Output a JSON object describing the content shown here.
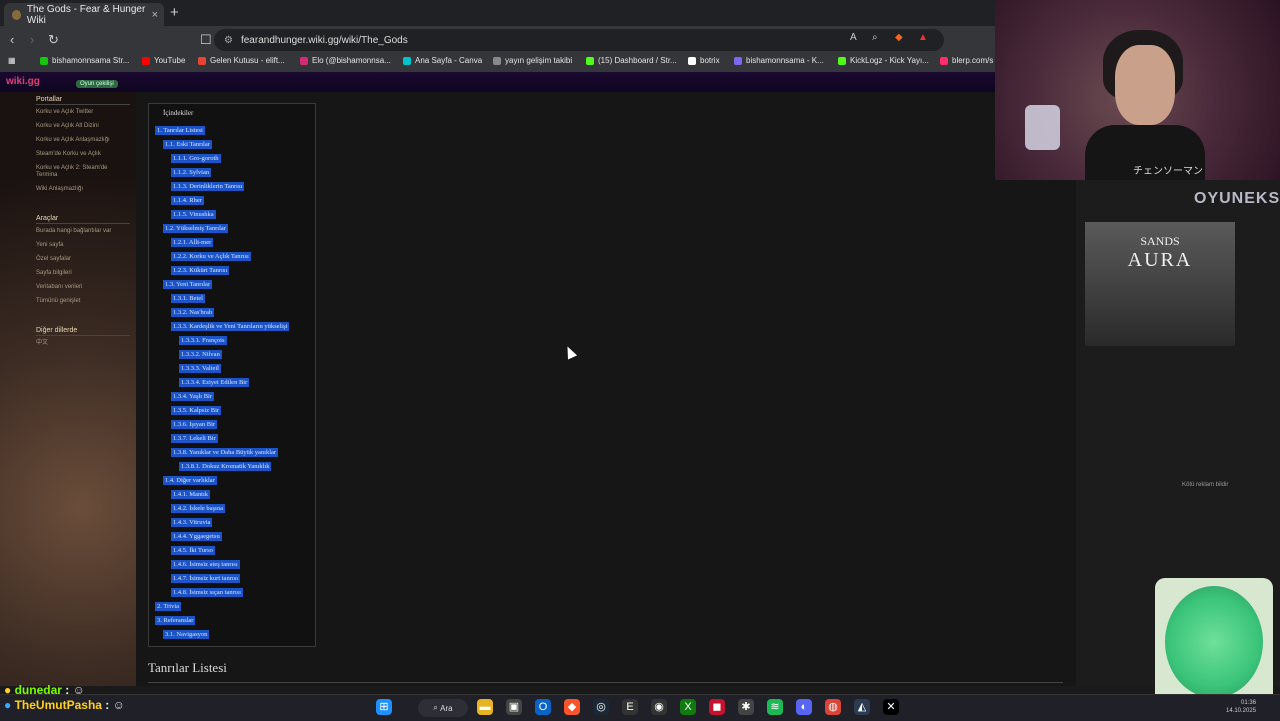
{
  "browser": {
    "tab_title": "The Gods - Fear & Hunger Wiki",
    "tab_close": "×",
    "new_tab": "+",
    "url": "fearandhunger.wiki.gg/wiki/The_Gods",
    "bookmarks": [
      {
        "label": "bishamonnsama Str...",
        "color": "#16c60c"
      },
      {
        "label": "YouTube",
        "color": "#ff0000"
      },
      {
        "label": "Gelen Kutusu - elift...",
        "color": "#ea4335"
      },
      {
        "label": "Elo (@bishamonnsa...",
        "color": "#d62976"
      },
      {
        "label": "Ana Sayfa - Canva",
        "color": "#00c4cc"
      },
      {
        "label": "yayın gelişim takibi",
        "color": "#888888"
      },
      {
        "label": "(15) Dashboard / Str...",
        "color": "#53fc18"
      },
      {
        "label": "botrix",
        "color": "#ffffff"
      },
      {
        "label": "bishamonnsama - K...",
        "color": "#7b68ee"
      },
      {
        "label": "KickLogz - Kick Yayı...",
        "color": "#53fc18"
      },
      {
        "label": "blerp.com/s",
        "color": "#ff2d6b"
      }
    ]
  },
  "wiki": {
    "logo": "wiki.gg",
    "badge": "Oyun çekilişi"
  },
  "sidebar": {
    "portals_title": "Portallar",
    "portals": [
      "Korku ve Açlık Twitter",
      "Korku ve Açlık Alt Dizini",
      "Korku ve Açlık Anlaşmazlığı",
      "Steam'de Korku ve Açlık",
      "Korku ve Açlık 2: Steam'de Termina",
      "Wiki Anlaşmazlığı"
    ],
    "tools_title": "Araçlar",
    "tools": [
      "Burada hangi bağlantılar var",
      "Yeni sayfa",
      "Özel sayfalar",
      "Sayfa bilgileri",
      "Veritabanı verileri",
      "Tümünü genişlet"
    ],
    "langs_title": "Diğer dillerde",
    "langs": [
      "中文"
    ]
  },
  "toc": {
    "title": "İçindekiler",
    "items": [
      {
        "num": "1.",
        "label": "Tanrılar Listesi",
        "level": 0
      },
      {
        "num": "1.1.",
        "label": "Eski Tanrılar",
        "level": 1
      },
      {
        "num": "1.1.1.",
        "label": "Gro-goroth",
        "level": 2
      },
      {
        "num": "1.1.2.",
        "label": "Sylvian",
        "level": 2
      },
      {
        "num": "1.1.3.",
        "label": "Derinliklerin Tanrısı",
        "level": 2
      },
      {
        "num": "1.1.4.",
        "label": "Rher",
        "level": 2
      },
      {
        "num": "1.1.5.",
        "label": "Vinushka",
        "level": 2
      },
      {
        "num": "1.2.",
        "label": "Yükselmiş Tanrılar",
        "level": 1
      },
      {
        "num": "1.2.1.",
        "label": "Allt-mer",
        "level": 2
      },
      {
        "num": "1.2.2.",
        "label": "Korku ve Açlık Tanrısı",
        "level": 2
      },
      {
        "num": "1.2.3.",
        "label": "Kükürt Tanrısı",
        "level": 2
      },
      {
        "num": "1.3.",
        "label": "Yeni Tanrılar",
        "level": 1
      },
      {
        "num": "1.3.1.",
        "label": "Betel",
        "level": 2
      },
      {
        "num": "1.3.2.",
        "label": "Nas'hrah",
        "level": 2
      },
      {
        "num": "1.3.3.",
        "label": "Kardeşlik ve Yeni Tanrıların yükselişi",
        "level": 2
      },
      {
        "num": "1.3.3.1.",
        "label": "François",
        "level": 3
      },
      {
        "num": "1.3.3.2.",
        "label": "Nilvan",
        "level": 3
      },
      {
        "num": "1.3.3.3.",
        "label": "Valteil",
        "level": 3
      },
      {
        "num": "1.3.3.4.",
        "label": "Eziyet Edilen Bir",
        "level": 3
      },
      {
        "num": "1.3.4.",
        "label": "Yaşlı Bir",
        "level": 2
      },
      {
        "num": "1.3.5.",
        "label": "Kalpsiz Bir",
        "level": 2
      },
      {
        "num": "1.3.6.",
        "label": "Işıyan Bir",
        "level": 2
      },
      {
        "num": "1.3.7.",
        "label": "Lekeli Bir",
        "level": 2
      },
      {
        "num": "1.3.8.",
        "label": "Yanıklar ve Daha Büyük yanıklar",
        "level": 2
      },
      {
        "num": "1.3.8.1.",
        "label": "Dokuz Kromatik Yanıklık",
        "level": 3
      },
      {
        "num": "1.4.",
        "label": "Diğer varlıklar",
        "level": 1
      },
      {
        "num": "1.4.1.",
        "label": "Mantık",
        "level": 2
      },
      {
        "num": "1.4.2.",
        "label": "İskele başına",
        "level": 2
      },
      {
        "num": "1.4.3.",
        "label": "Vitruvia",
        "level": 2
      },
      {
        "num": "1.4.4.",
        "label": "Yggaegetsu",
        "level": 2
      },
      {
        "num": "1.4.5.",
        "label": "İki Turso",
        "level": 2
      },
      {
        "num": "1.4.6.",
        "label": "İsimsiz ateş tanrısı",
        "level": 2
      },
      {
        "num": "1.4.7.",
        "label": "İsimsiz kurt tanrısı",
        "level": 2
      },
      {
        "num": "1.4.8.",
        "label": "İsimsiz sıçan tanrısı",
        "level": 2
      },
      {
        "num": "2.",
        "label": "Trivia",
        "level": 0
      },
      {
        "num": "3.",
        "label": "Referanslar",
        "level": 0
      },
      {
        "num": "3.1.",
        "label": "Navigasyon",
        "level": 1
      }
    ]
  },
  "content": {
    "section_heading": "Tanrılar Listesi"
  },
  "ads": {
    "title_small": "SANDS",
    "title_big": "AURA",
    "report": "Kötü reklam bildir",
    "sponsor": "OYUNEKS"
  },
  "stream": {
    "shirt_text": "チェンソーマン",
    "chat": [
      {
        "user": "dunedar",
        "color": "#7CFC00"
      },
      {
        "user": "TheUmutPasha",
        "color": "#ffd11a"
      }
    ]
  },
  "taskbar": {
    "search_label": "Ara",
    "clock_time": "01:36",
    "clock_date": "14.10.2025"
  }
}
